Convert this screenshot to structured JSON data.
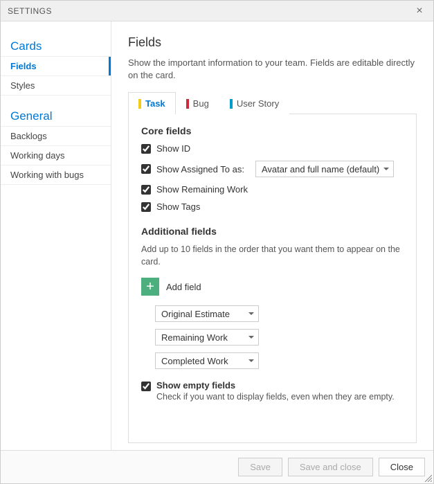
{
  "titlebar": {
    "title": "SETTINGS"
  },
  "sidebar": {
    "groups": [
      {
        "heading": "Cards",
        "items": [
          "Fields",
          "Styles"
        ],
        "activeIndex": 0
      },
      {
        "heading": "General",
        "items": [
          "Backlogs",
          "Working days",
          "Working with bugs"
        ]
      }
    ]
  },
  "page": {
    "title": "Fields",
    "desc": "Show the important information to your team. Fields are editable directly on the card."
  },
  "tabs": {
    "items": [
      {
        "label": "Task",
        "color": "task"
      },
      {
        "label": "Bug",
        "color": "bug"
      },
      {
        "label": "User Story",
        "color": "story"
      }
    ],
    "activeIndex": 0
  },
  "core": {
    "heading": "Core fields",
    "showId": "Show ID",
    "showAssigned": "Show Assigned To as:",
    "assignedValue": "Avatar and full name (default)",
    "showRemaining": "Show Remaining Work",
    "showTags": "Show Tags"
  },
  "additional": {
    "heading": "Additional fields",
    "sub": "Add up to 10 fields in the order that you want them to appear on the card.",
    "addLabel": "Add field",
    "fields": [
      "Original Estimate",
      "Remaining Work",
      "Completed Work"
    ]
  },
  "empty": {
    "label": "Show empty fields",
    "sub": "Check if you want to display fields, even when they are empty."
  },
  "footer": {
    "save": "Save",
    "saveClose": "Save and close",
    "close": "Close"
  }
}
